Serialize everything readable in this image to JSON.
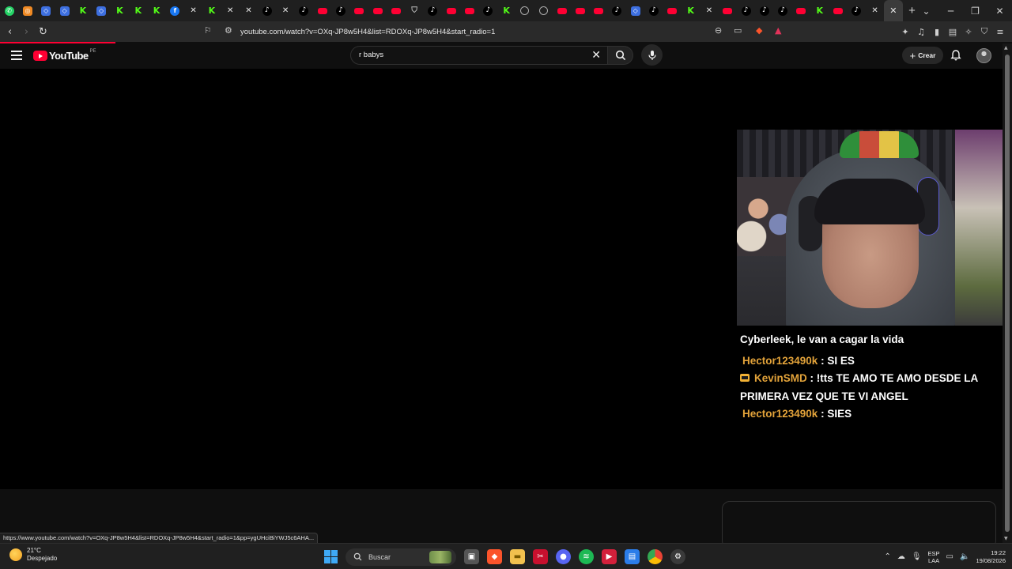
{
  "browser": {
    "tabs": [
      {
        "icon": "whatsapp-icon"
      },
      {
        "icon": "instagram-icon"
      },
      {
        "icon": "roblox-icon"
      },
      {
        "icon": "roblox-icon"
      },
      {
        "icon": "kick-icon"
      },
      {
        "icon": "roblox-icon"
      },
      {
        "icon": "kick-icon"
      },
      {
        "icon": "kick-icon"
      },
      {
        "icon": "kick-icon"
      },
      {
        "icon": "facebook-icon"
      },
      {
        "icon": "x-icon"
      },
      {
        "icon": "kick-icon"
      },
      {
        "icon": "x-icon"
      },
      {
        "icon": "x-icon"
      },
      {
        "icon": "tiktok-icon"
      },
      {
        "icon": "x-icon"
      },
      {
        "icon": "tiktok-icon"
      },
      {
        "icon": "youtube-icon"
      },
      {
        "icon": "tiktok-icon"
      },
      {
        "icon": "youtube-icon"
      },
      {
        "icon": "youtube-icon"
      },
      {
        "icon": "youtube-icon"
      },
      {
        "icon": "shield-icon"
      },
      {
        "icon": "tiktok-icon"
      },
      {
        "icon": "youtube-icon"
      },
      {
        "icon": "youtube-icon"
      },
      {
        "icon": "tiktok-icon"
      },
      {
        "icon": "kick-icon"
      },
      {
        "icon": "globe-icon"
      },
      {
        "icon": "globe-icon"
      },
      {
        "icon": "youtube-icon"
      },
      {
        "icon": "youtube-icon"
      },
      {
        "icon": "youtube-icon"
      },
      {
        "icon": "tiktok-icon"
      },
      {
        "icon": "roblox-icon"
      },
      {
        "icon": "tiktok-icon"
      },
      {
        "icon": "youtube-icon"
      },
      {
        "icon": "kick-icon"
      },
      {
        "icon": "x-icon"
      },
      {
        "icon": "youtube-icon"
      },
      {
        "icon": "tiktok-icon"
      },
      {
        "icon": "tiktok-icon"
      },
      {
        "icon": "tiktok-icon"
      },
      {
        "icon": "youtube-icon"
      },
      {
        "icon": "kick-icon"
      },
      {
        "icon": "youtube-icon"
      },
      {
        "icon": "tiktok-icon"
      },
      {
        "icon": "x-icon"
      },
      {
        "icon": "close-icon",
        "active": true
      }
    ],
    "url": "youtube.com/watch?v=OXq-JP8w5H4&list=RDOXq-JP8w5H4&start_radio=1",
    "status_url": "https://www.youtube.com/watch?v=OXq-JP8w5H4&list=RDOXq-JP8w5H4&start_radio=1&pp=ygUHciBiYWJ5c6AHA...",
    "accent": "#ff0033"
  },
  "youtube": {
    "logo_text": "YouTube",
    "country_code": "PE",
    "search_value": "r babys",
    "create_label": "Crear"
  },
  "stream_chat": [
    {
      "user": "",
      "text": "Cyberleek, le van a cagar la vida"
    },
    {
      "user": "Hector123490k",
      "text": " : SI ES"
    },
    {
      "user": "KevinSMD",
      "text": " : !tts TE AMO TE AMO DESDE LA PRIMERA VEZ QUE TE VI ANGEL",
      "badge": true
    },
    {
      "user": "Hector123490k",
      "text": " : SIES"
    }
  ],
  "taskbar": {
    "temperature": "21°C",
    "weather": "Despejado",
    "search_label": "Buscar",
    "lang_1": "ESP",
    "lang_2": "LAA",
    "time": "19:22",
    "date": "19/08/2026"
  }
}
